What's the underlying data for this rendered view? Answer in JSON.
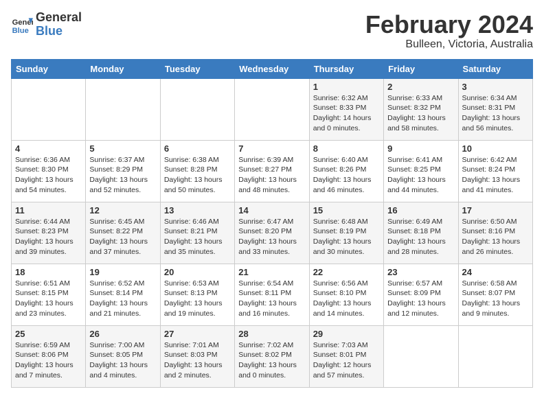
{
  "header": {
    "logo_line1": "General",
    "logo_line2": "Blue",
    "month_title": "February 2024",
    "location": "Bulleen, Victoria, Australia"
  },
  "weekdays": [
    "Sunday",
    "Monday",
    "Tuesday",
    "Wednesday",
    "Thursday",
    "Friday",
    "Saturday"
  ],
  "weeks": [
    [
      {
        "day": "",
        "sunrise": "",
        "sunset": "",
        "daylight": ""
      },
      {
        "day": "",
        "sunrise": "",
        "sunset": "",
        "daylight": ""
      },
      {
        "day": "",
        "sunrise": "",
        "sunset": "",
        "daylight": ""
      },
      {
        "day": "",
        "sunrise": "",
        "sunset": "",
        "daylight": ""
      },
      {
        "day": "1",
        "sunrise": "Sunrise: 6:32 AM",
        "sunset": "Sunset: 8:33 PM",
        "daylight": "Daylight: 14 hours and 0 minutes."
      },
      {
        "day": "2",
        "sunrise": "Sunrise: 6:33 AM",
        "sunset": "Sunset: 8:32 PM",
        "daylight": "Daylight: 13 hours and 58 minutes."
      },
      {
        "day": "3",
        "sunrise": "Sunrise: 6:34 AM",
        "sunset": "Sunset: 8:31 PM",
        "daylight": "Daylight: 13 hours and 56 minutes."
      }
    ],
    [
      {
        "day": "4",
        "sunrise": "Sunrise: 6:36 AM",
        "sunset": "Sunset: 8:30 PM",
        "daylight": "Daylight: 13 hours and 54 minutes."
      },
      {
        "day": "5",
        "sunrise": "Sunrise: 6:37 AM",
        "sunset": "Sunset: 8:29 PM",
        "daylight": "Daylight: 13 hours and 52 minutes."
      },
      {
        "day": "6",
        "sunrise": "Sunrise: 6:38 AM",
        "sunset": "Sunset: 8:28 PM",
        "daylight": "Daylight: 13 hours and 50 minutes."
      },
      {
        "day": "7",
        "sunrise": "Sunrise: 6:39 AM",
        "sunset": "Sunset: 8:27 PM",
        "daylight": "Daylight: 13 hours and 48 minutes."
      },
      {
        "day": "8",
        "sunrise": "Sunrise: 6:40 AM",
        "sunset": "Sunset: 8:26 PM",
        "daylight": "Daylight: 13 hours and 46 minutes."
      },
      {
        "day": "9",
        "sunrise": "Sunrise: 6:41 AM",
        "sunset": "Sunset: 8:25 PM",
        "daylight": "Daylight: 13 hours and 44 minutes."
      },
      {
        "day": "10",
        "sunrise": "Sunrise: 6:42 AM",
        "sunset": "Sunset: 8:24 PM",
        "daylight": "Daylight: 13 hours and 41 minutes."
      }
    ],
    [
      {
        "day": "11",
        "sunrise": "Sunrise: 6:44 AM",
        "sunset": "Sunset: 8:23 PM",
        "daylight": "Daylight: 13 hours and 39 minutes."
      },
      {
        "day": "12",
        "sunrise": "Sunrise: 6:45 AM",
        "sunset": "Sunset: 8:22 PM",
        "daylight": "Daylight: 13 hours and 37 minutes."
      },
      {
        "day": "13",
        "sunrise": "Sunrise: 6:46 AM",
        "sunset": "Sunset: 8:21 PM",
        "daylight": "Daylight: 13 hours and 35 minutes."
      },
      {
        "day": "14",
        "sunrise": "Sunrise: 6:47 AM",
        "sunset": "Sunset: 8:20 PM",
        "daylight": "Daylight: 13 hours and 33 minutes."
      },
      {
        "day": "15",
        "sunrise": "Sunrise: 6:48 AM",
        "sunset": "Sunset: 8:19 PM",
        "daylight": "Daylight: 13 hours and 30 minutes."
      },
      {
        "day": "16",
        "sunrise": "Sunrise: 6:49 AM",
        "sunset": "Sunset: 8:18 PM",
        "daylight": "Daylight: 13 hours and 28 minutes."
      },
      {
        "day": "17",
        "sunrise": "Sunrise: 6:50 AM",
        "sunset": "Sunset: 8:16 PM",
        "daylight": "Daylight: 13 hours and 26 minutes."
      }
    ],
    [
      {
        "day": "18",
        "sunrise": "Sunrise: 6:51 AM",
        "sunset": "Sunset: 8:15 PM",
        "daylight": "Daylight: 13 hours and 23 minutes."
      },
      {
        "day": "19",
        "sunrise": "Sunrise: 6:52 AM",
        "sunset": "Sunset: 8:14 PM",
        "daylight": "Daylight: 13 hours and 21 minutes."
      },
      {
        "day": "20",
        "sunrise": "Sunrise: 6:53 AM",
        "sunset": "Sunset: 8:13 PM",
        "daylight": "Daylight: 13 hours and 19 minutes."
      },
      {
        "day": "21",
        "sunrise": "Sunrise: 6:54 AM",
        "sunset": "Sunset: 8:11 PM",
        "daylight": "Daylight: 13 hours and 16 minutes."
      },
      {
        "day": "22",
        "sunrise": "Sunrise: 6:56 AM",
        "sunset": "Sunset: 8:10 PM",
        "daylight": "Daylight: 13 hours and 14 minutes."
      },
      {
        "day": "23",
        "sunrise": "Sunrise: 6:57 AM",
        "sunset": "Sunset: 8:09 PM",
        "daylight": "Daylight: 13 hours and 12 minutes."
      },
      {
        "day": "24",
        "sunrise": "Sunrise: 6:58 AM",
        "sunset": "Sunset: 8:07 PM",
        "daylight": "Daylight: 13 hours and 9 minutes."
      }
    ],
    [
      {
        "day": "25",
        "sunrise": "Sunrise: 6:59 AM",
        "sunset": "Sunset: 8:06 PM",
        "daylight": "Daylight: 13 hours and 7 minutes."
      },
      {
        "day": "26",
        "sunrise": "Sunrise: 7:00 AM",
        "sunset": "Sunset: 8:05 PM",
        "daylight": "Daylight: 13 hours and 4 minutes."
      },
      {
        "day": "27",
        "sunrise": "Sunrise: 7:01 AM",
        "sunset": "Sunset: 8:03 PM",
        "daylight": "Daylight: 13 hours and 2 minutes."
      },
      {
        "day": "28",
        "sunrise": "Sunrise: 7:02 AM",
        "sunset": "Sunset: 8:02 PM",
        "daylight": "Daylight: 13 hours and 0 minutes."
      },
      {
        "day": "29",
        "sunrise": "Sunrise: 7:03 AM",
        "sunset": "Sunset: 8:01 PM",
        "daylight": "Daylight: 12 hours and 57 minutes."
      },
      {
        "day": "",
        "sunrise": "",
        "sunset": "",
        "daylight": ""
      },
      {
        "day": "",
        "sunrise": "",
        "sunset": "",
        "daylight": ""
      }
    ]
  ]
}
